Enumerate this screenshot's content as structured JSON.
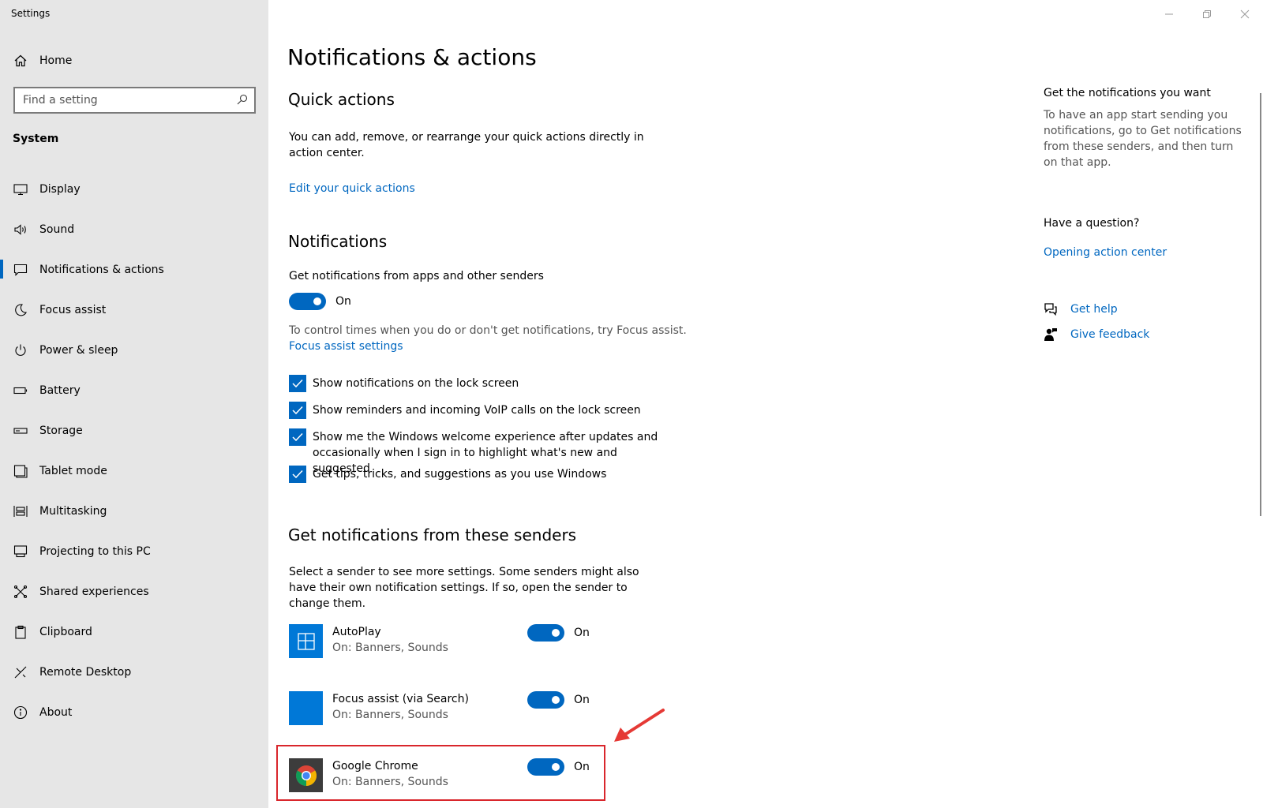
{
  "window": {
    "title": "Settings"
  },
  "sidebar": {
    "home_label": "Home",
    "search_placeholder": "Find a setting",
    "section": "System",
    "items": [
      {
        "label": "Display",
        "icon": "display-icon"
      },
      {
        "label": "Sound",
        "icon": "speaker-icon"
      },
      {
        "label": "Notifications & actions",
        "icon": "notification-icon",
        "active": true
      },
      {
        "label": "Focus assist",
        "icon": "moon-icon"
      },
      {
        "label": "Power & sleep",
        "icon": "power-icon"
      },
      {
        "label": "Battery",
        "icon": "battery-icon"
      },
      {
        "label": "Storage",
        "icon": "storage-icon"
      },
      {
        "label": "Tablet mode",
        "icon": "tablet-icon"
      },
      {
        "label": "Multitasking",
        "icon": "multitasking-icon"
      },
      {
        "label": "Projecting to this PC",
        "icon": "projector-icon"
      },
      {
        "label": "Shared experiences",
        "icon": "shared-icon"
      },
      {
        "label": "Clipboard",
        "icon": "clipboard-icon"
      },
      {
        "label": "Remote Desktop",
        "icon": "remote-icon"
      },
      {
        "label": "About",
        "icon": "info-icon"
      }
    ]
  },
  "main": {
    "title": "Notifications & actions",
    "quick_actions": {
      "heading": "Quick actions",
      "description": "You can add, remove, or rearrange your quick actions directly in action center.",
      "link": "Edit your quick actions"
    },
    "notifications": {
      "heading": "Notifications",
      "toggle_label": "Get notifications from apps and other senders",
      "toggle_state": "On",
      "focus_text": "To control times when you do or don't get notifications, try Focus assist.",
      "focus_link": "Focus assist settings",
      "checkboxes": [
        {
          "label": "Show notifications on the lock screen",
          "checked": true
        },
        {
          "label": "Show reminders and incoming VoIP calls on the lock screen",
          "checked": true
        },
        {
          "label": "Show me the Windows welcome experience after updates and occasionally when I sign in to highlight what's new and suggested",
          "checked": true
        },
        {
          "label": "Get tips, tricks, and suggestions as you use Windows",
          "checked": true
        }
      ]
    },
    "senders": {
      "heading": "Get notifications from these senders",
      "description": "Select a sender to see more settings. Some senders might also have their own notification settings. If so, open the sender to change them.",
      "items": [
        {
          "name": "AutoPlay",
          "detail": "On: Banners, Sounds",
          "state": "On",
          "icon": "autoplay-icon"
        },
        {
          "name": "Focus assist (via Search)",
          "detail": "On: Banners, Sounds",
          "state": "On",
          "icon": "focus-assist-tile-icon"
        },
        {
          "name": "Google Chrome",
          "detail": "On: Banners, Sounds",
          "state": "On",
          "icon": "chrome-icon"
        }
      ]
    }
  },
  "right_panel": {
    "heading1": "Get the notifications you want",
    "text1": "To have an app start sending you notifications, go to Get notifications from these senders, and then turn on that app.",
    "heading2": "Have a question?",
    "link1": "Opening action center",
    "help": "Get help",
    "feedback": "Give feedback"
  },
  "colors": {
    "accent": "#0067c0",
    "highlight": "#d9262c",
    "sidebar_bg": "#e6e6e6"
  }
}
